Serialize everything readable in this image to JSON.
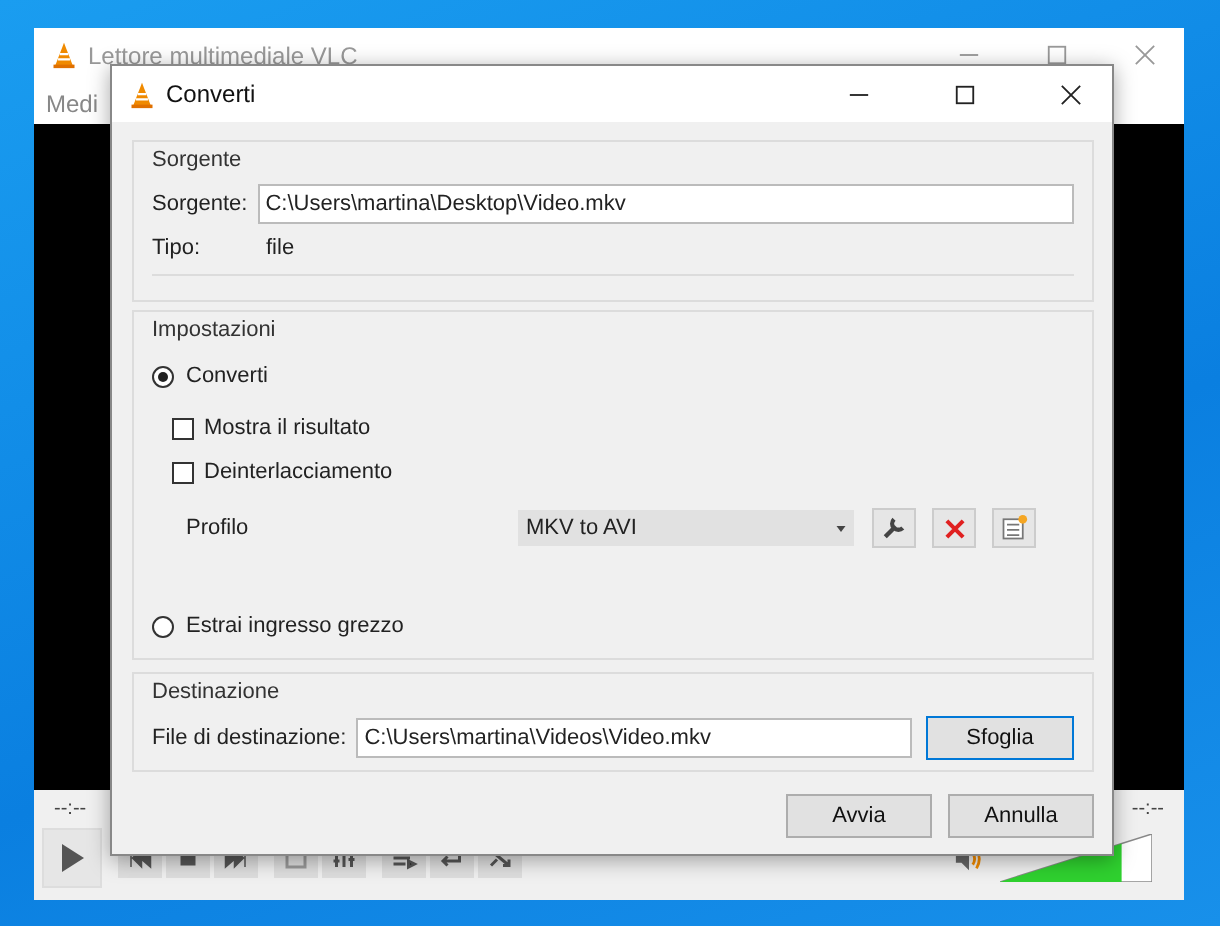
{
  "vlc_window": {
    "title": "Lettore multimediale VLC",
    "menu": [
      "Medi"
    ],
    "elapsed": "--:--",
    "remaining": "--:--",
    "volume": {
      "level": 0.8
    }
  },
  "dialog": {
    "title": "Converti",
    "source": {
      "heading": "Sorgente",
      "label": "Sorgente:",
      "value": "C:\\Users\\martina\\Desktop\\Video.mkv",
      "type_label": "Tipo:",
      "type_value": "file"
    },
    "settings": {
      "heading": "Impostazioni",
      "options": [
        {
          "label": "Converti",
          "selected": true
        },
        {
          "label": "Estrai ingresso grezzo",
          "selected": false
        }
      ],
      "checkboxes": [
        {
          "label": "Mostra il risultato",
          "checked": false
        },
        {
          "label": "Deinterlacciamento",
          "checked": false
        }
      ],
      "profile_label": "Profilo",
      "profile": "MKV to AVI"
    },
    "destination": {
      "heading": "Destinazione",
      "label": "File di destinazione:",
      "value": "C:\\Users\\martina\\Videos\\Video.mkv",
      "browse": "Sfoglia"
    },
    "buttons": [
      "Avvia",
      "Annulla"
    ]
  }
}
